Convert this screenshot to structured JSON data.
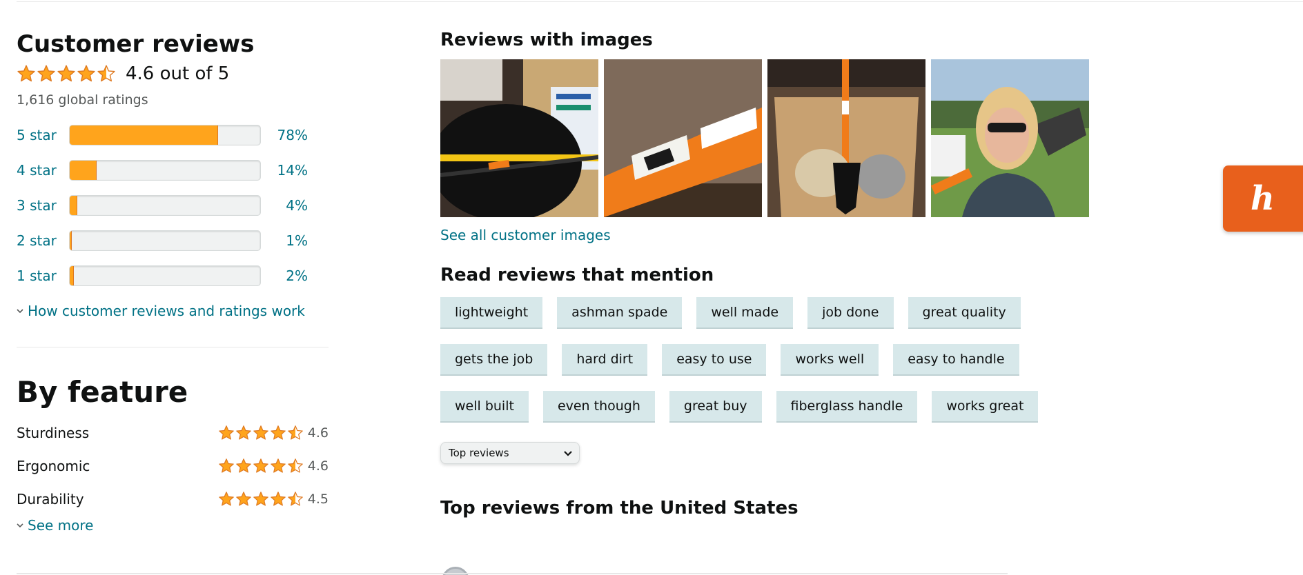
{
  "colors": {
    "accent_link": "#007185",
    "star": "#ffa41c",
    "chip_bg": "#d7e8ea",
    "honey": "#e8601c"
  },
  "customer_reviews": {
    "title": "Customer reviews",
    "average_text": "4.6 out of 5",
    "average_value": 4.6,
    "global_ratings": "1,616 global ratings",
    "histogram": [
      {
        "label": "5 star",
        "percent_label": "78%",
        "percent": 78
      },
      {
        "label": "4 star",
        "percent_label": "14%",
        "percent": 14
      },
      {
        "label": "3 star",
        "percent_label": "4%",
        "percent": 4
      },
      {
        "label": "2 star",
        "percent_label": "1%",
        "percent": 1
      },
      {
        "label": "1 star",
        "percent_label": "2%",
        "percent": 2
      }
    ],
    "how_link": "How customer reviews and ratings work"
  },
  "by_feature": {
    "title": "By feature",
    "features": [
      {
        "name": "Sturdiness",
        "value": "4.6",
        "rating": 4.6
      },
      {
        "name": "Ergonomic",
        "value": "4.6",
        "rating": 4.6
      },
      {
        "name": "Durability",
        "value": "4.5",
        "rating": 4.5
      }
    ],
    "see_more": "See more"
  },
  "reviews_with_images": {
    "title": "Reviews with images",
    "images": [
      "shovel-on-tape-measure",
      "orange-handle-closeup",
      "shovel-in-box",
      "woman-holding-shovel"
    ],
    "see_all": "See all customer images"
  },
  "mentions": {
    "title": "Read reviews that mention",
    "rows": [
      [
        "lightweight",
        "ashman spade",
        "well made",
        "job done",
        "great quality"
      ],
      [
        "gets the job",
        "hard dirt",
        "easy to use",
        "works well",
        "easy to handle"
      ],
      [
        "well built",
        "even though",
        "great buy",
        "fiberglass handle",
        "works great"
      ]
    ]
  },
  "sort": {
    "selected": "Top reviews",
    "icon": "chevron-down-icon"
  },
  "top_reviews_title": "Top reviews from the United States",
  "honey": {
    "glyph": "h",
    "icon": "honey-extension-icon"
  }
}
